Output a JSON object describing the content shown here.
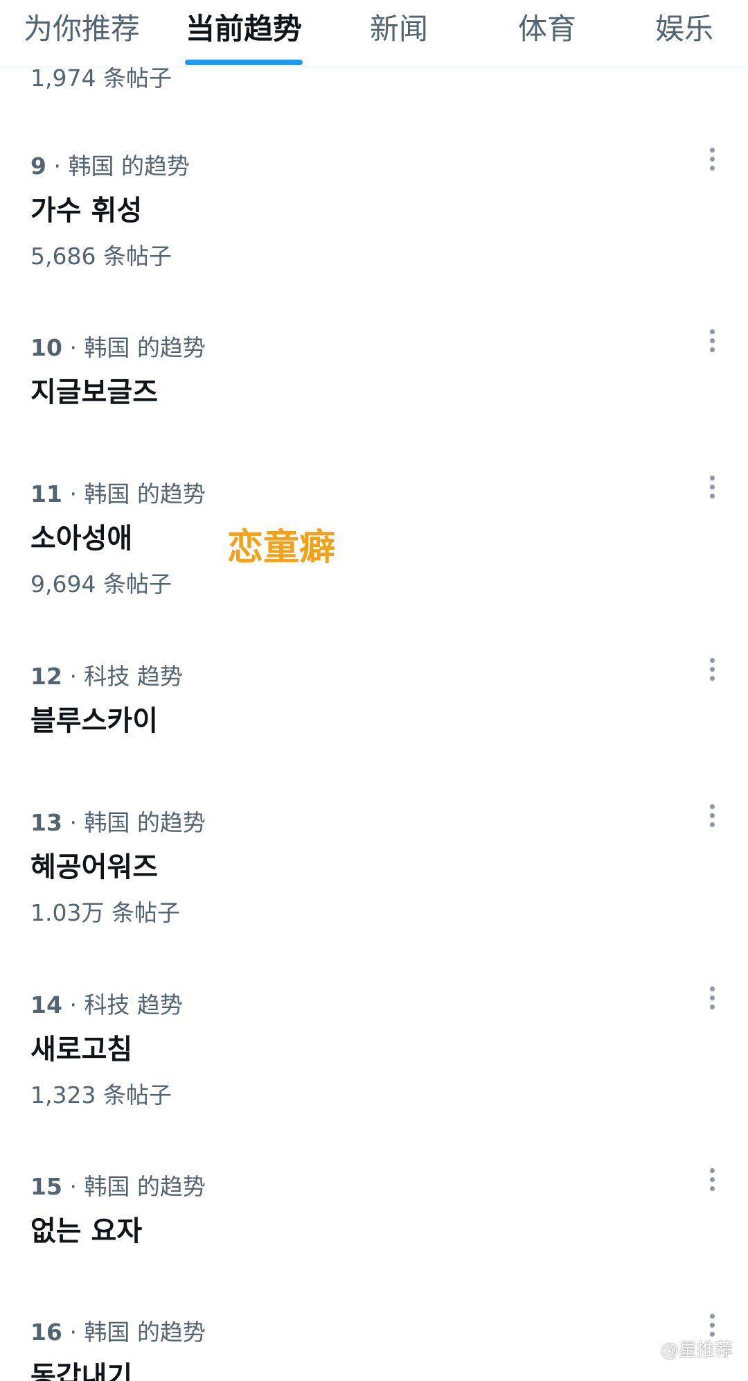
{
  "tabs": [
    {
      "label": "为你推荐",
      "active": false
    },
    {
      "label": "当前趋势",
      "active": true
    },
    {
      "label": "新闻",
      "active": false
    },
    {
      "label": "体育",
      "active": false
    },
    {
      "label": "娱乐",
      "active": false
    }
  ],
  "previous_item_tail": "1,974 条帖子",
  "trends": [
    {
      "rank": "9",
      "category": "韩国 的趋势",
      "name": "가수 휘성",
      "count": "5,686 条帖子"
    },
    {
      "rank": "10",
      "category": "韩国 的趋势",
      "name": "지글보글즈",
      "count": ""
    },
    {
      "rank": "11",
      "category": "韩国 的趋势",
      "name": "소아성애",
      "count": "9,694 条帖子"
    },
    {
      "rank": "12",
      "category": "科技 趋势",
      "name": "블루스카이",
      "count": ""
    },
    {
      "rank": "13",
      "category": "韩国 的趋势",
      "name": "혜공어워즈",
      "count": "1.03万 条帖子"
    },
    {
      "rank": "14",
      "category": "科技 趋势",
      "name": "새로고침",
      "count": "1,323 条帖子"
    },
    {
      "rank": "15",
      "category": "韩国 的趋势",
      "name": "없는 요자",
      "count": ""
    },
    {
      "rank": "16",
      "category": "韩国 的趋势",
      "name": "동갑내기",
      "count": ""
    }
  ],
  "overlay_caption": "恋童癖",
  "watermark": "@星推荐",
  "icons": {
    "more": "more-options-icon"
  },
  "colors": {
    "accent": "#1d9bf0",
    "secondary_text": "#536471",
    "primary_text": "#0f1419",
    "caption": "#f2a21a"
  }
}
